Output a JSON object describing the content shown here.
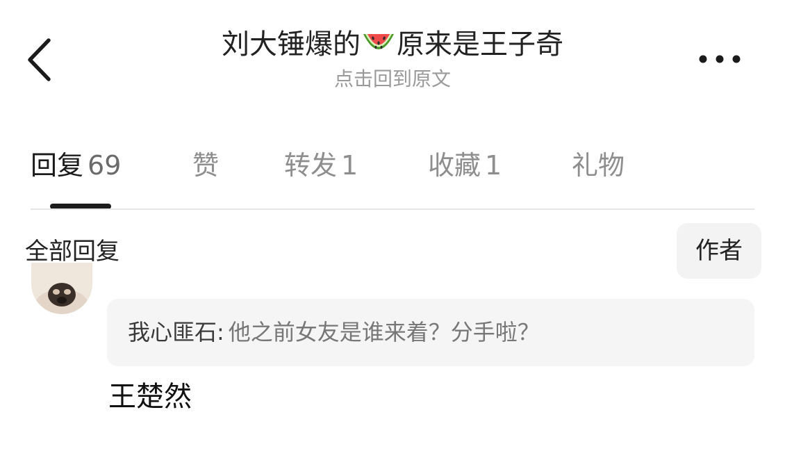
{
  "header": {
    "title_before": "刘大锤爆的",
    "title_emoji": "watermelon-emoji",
    "title_after": "原来是王子奇",
    "subtitle": "点击回到原文",
    "back_icon": "chevron-left-icon",
    "more_icon": "more-horizontal-icon"
  },
  "tabs": [
    {
      "label": "回复",
      "count": "69",
      "active": true
    },
    {
      "label": "赞",
      "count": ""
    },
    {
      "label": "转发",
      "count": "1"
    },
    {
      "label": "收藏",
      "count": "1"
    },
    {
      "label": "礼物",
      "count": ""
    }
  ],
  "section": {
    "title": "全部回复",
    "author_filter": "作者"
  },
  "reply": {
    "avatar_icon": "user-avatar",
    "quote_user": "我心匪石",
    "quote_sep": ":",
    "quote_text": "他之前女友是谁来着？分手啦？",
    "text": "王楚然"
  },
  "colors": {
    "text_primary": "#222222",
    "text_secondary": "#9a9a9a",
    "chip_bg": "#f3f3f3",
    "quote_bg": "#f5f5f5",
    "divider": "#e6e6e6"
  }
}
